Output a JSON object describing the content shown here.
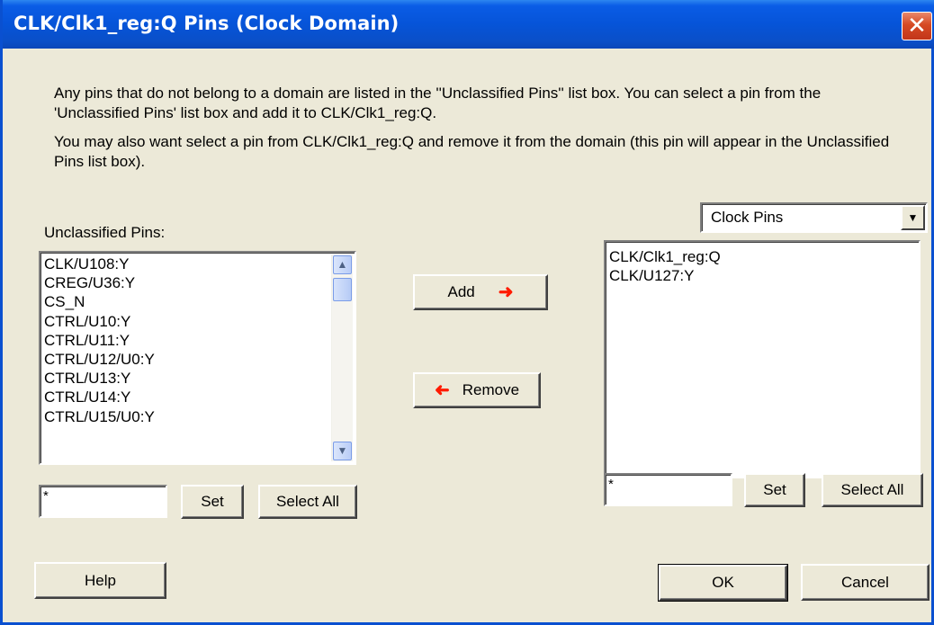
{
  "window": {
    "title": "CLK/Clk1_reg:Q Pins (Clock Domain)",
    "close_glyph": "✕"
  },
  "description": {
    "para1": "Any pins that do not belong to a domain are listed in the ''Unclassified Pins'' list box. You can select a pin from the 'Unclassified Pins' list box and add it to CLK/Clk1_reg:Q.",
    "para2": "You may also want select a pin from CLK/Clk1_reg:Q and remove it from the domain (this pin will appear in the Unclassified Pins list box)."
  },
  "left_panel": {
    "label": "Unclassified Pins:",
    "items": [
      "CLK/U108:Y",
      "CREG/U36:Y",
      "CS_N",
      "CTRL/U10:Y",
      "CTRL/U11:Y",
      "CTRL/U12/U0:Y",
      "CTRL/U13:Y",
      "CTRL/U14:Y",
      "CTRL/U15/U0:Y"
    ],
    "filter_value": "*",
    "set_label": "Set",
    "select_all_label": "Select All",
    "scroll_up_icon": "scroll-up-arrow",
    "scroll_down_icon": "scroll-down-arrow"
  },
  "middle": {
    "add_label": "Add",
    "remove_label": "Remove",
    "add_icon": "arrow-right-icon",
    "remove_icon": "arrow-left-icon",
    "arrow_color": "#ff1a00"
  },
  "right_panel": {
    "dropdown_value": "Clock Pins",
    "items": [
      "CLK/Clk1_reg:Q",
      "CLK/U127:Y"
    ],
    "filter_value": "*",
    "set_label": "Set",
    "select_all_label": "Select All"
  },
  "footer": {
    "help_label": "Help",
    "ok_label": "OK",
    "cancel_label": "Cancel"
  },
  "colors": {
    "titlebar": "#0654d8",
    "dialog_bg": "#ece9d8",
    "close_button": "#d64a24"
  }
}
